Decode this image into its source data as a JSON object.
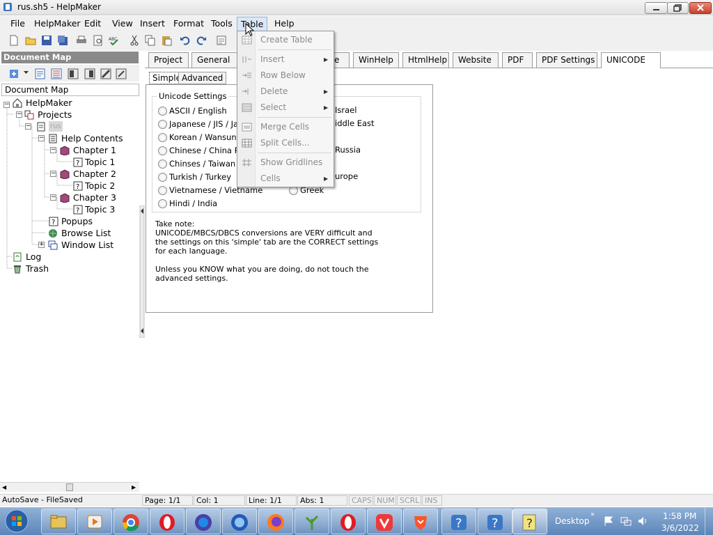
{
  "window": {
    "title": "rus.sh5 - HelpMaker"
  },
  "menubar": {
    "items": [
      "File",
      "HelpMaker",
      "Edit",
      "View",
      "Insert",
      "Format",
      "Tools",
      "Table",
      "Help"
    ]
  },
  "docmap": {
    "header": "Document Map",
    "title": "Document Map",
    "tree": {
      "root": "HelpMaker",
      "projects": "Projects",
      "project_name": "rus",
      "help_contents": "Help Contents",
      "chapter1": "Chapter 1",
      "topic1": "Topic 1",
      "chapter2": "Chapter 2",
      "topic2": "Topic 2",
      "chapter3": "Chapter 3",
      "topic3": "Topic 3",
      "popups": "Popups",
      "browse_list": "Browse List",
      "window_list": "Window List",
      "log": "Log",
      "trash": "Trash"
    }
  },
  "tabs": [
    "Project",
    "General",
    "",
    "e",
    "WinHelp",
    "HtmlHelp",
    "Website",
    "PDF",
    "PDF Settings",
    "UNICODE"
  ],
  "subtabs": [
    "Simple",
    "Advanced"
  ],
  "unicode": {
    "group_label": "Unicode Settings",
    "left_options": [
      "ASCII / English",
      "Japanese / JIS / Jap",
      "Korean / Wansung",
      "Chinese / China PRC",
      "Chinses / Taiwan",
      "Turkish / Turkey",
      "Vietnamese / Vietname",
      "Hindi / India"
    ],
    "right_options": [
      "Israel",
      "iddle East",
      "",
      "Russia",
      "",
      "urope",
      "Greek"
    ],
    "note_title": "Take note:",
    "note_body": "UNICODE/MBCS/DBCS conversions are VERY difficult and the settings on this 'simple' tab are the CORRECT settings for each language.",
    "note_warning": "Unless you KNOW what you are doing, do not touch the advanced settings."
  },
  "table_menu": {
    "items": [
      "Create Table",
      "Insert",
      "Row Below",
      "Delete",
      "Select",
      "Merge Cells",
      "Split Cells...",
      "Show Gridlines",
      "Cells"
    ]
  },
  "statusbar": {
    "autosave": "AutoSave - FileSaved",
    "page": "Page: 1/1",
    "col": "Col: 1",
    "line": "Line: 1/1",
    "abs": "Abs: 1",
    "caps": "CAPS",
    "num": "NUM",
    "scrl": "SCRL",
    "ins": "INS"
  },
  "taskbar": {
    "desktop": "Desktop",
    "time": "1:58 PM",
    "date": "3/6/2022"
  },
  "colors": {
    "accent": "#dbe7f6",
    "taskbar": "#6f95c4",
    "docmap_header": "#8a8a8a"
  }
}
